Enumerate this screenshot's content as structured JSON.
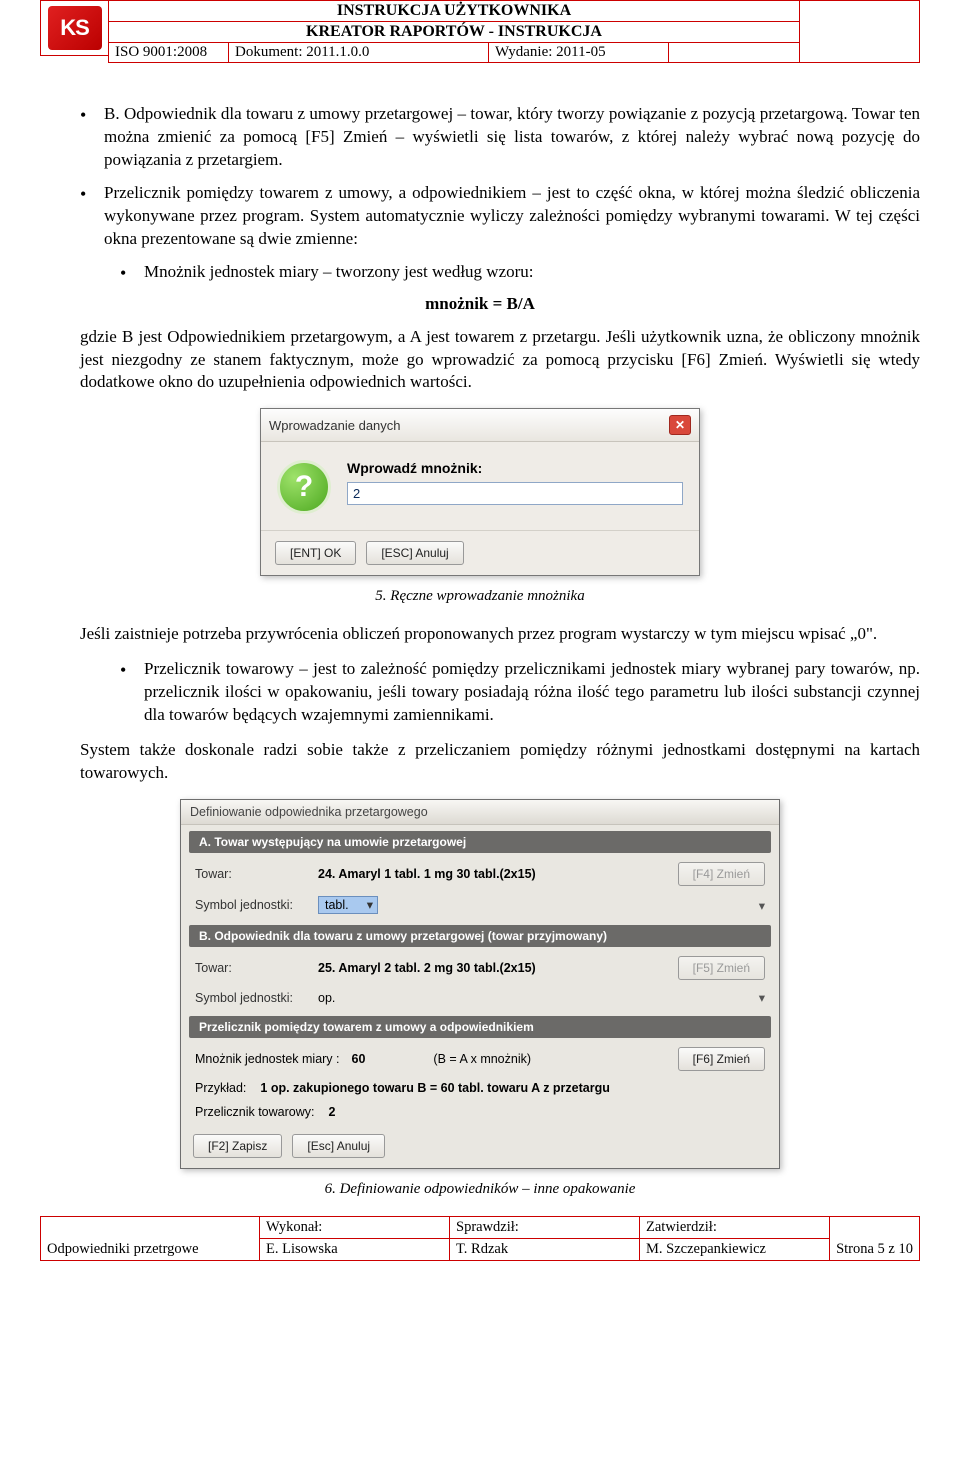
{
  "header": {
    "logo": "KS",
    "title1": "INSTRUKCJA UŻYTKOWNIKA",
    "title2": "KREATOR RAPORTÓW - INSTRUKCJA",
    "iso": "ISO 9001:2008",
    "doc": "Dokument: 2011.1.0.0",
    "wyd": "Wydanie: 2011-05"
  },
  "body": {
    "bullet_b": "B. Odpowiednik dla towaru z umowy przetargowej – towar, który tworzy powiązanie z pozycją przetargową. Towar ten można zmienić za pomocą [F5] Zmień – wyświetli się lista towarów, z której należy wybrać nową pozycję do powiązania z przetargiem.",
    "bullet_prz": "Przelicznik pomiędzy towarem z umowy, a odpowiednikiem – jest to część okna, w której można śledzić obliczenia wykonywane przez program. System automatycznie wyliczy zależności pomiędzy wybranymi towarami. W tej części okna prezentowane są dwie zmienne:",
    "sub_mnoz": "Mnożnik jednostek miary – tworzony jest według wzoru:",
    "formula": "mnożnik = B/A",
    "para_gdzie": "gdzie B jest Odpowiednikiem przetargowym, a A jest towarem z przetargu. Jeśli użytkownik uzna, że obliczony mnożnik jest niezgodny ze stanem faktycznym, może go wprowadzić za pomocą przycisku [F6] Zmień. Wyświetli się wtedy dodatkowe okno do uzupełnienia odpowiednich wartości.",
    "caption5": "5.  Ręczne wprowadzanie mnożnika",
    "para_jesli": "Jeśli zaistnieje potrzeba przywrócenia obliczeń proponowanych przez program wystarczy w tym miejscu wpisać „0\".",
    "bullet_prz_tow": "Przelicznik towarowy – jest to zależność pomiędzy przelicznikami jednostek miary wybranej pary towarów, np. przelicznik ilości w opakowaniu, jeśli towary posiadają różna ilość tego parametru lub ilości substancji czynnej dla towarów będących wzajemnymi zamiennikami.",
    "para_system": "System także doskonale radzi sobie także z przeliczaniem pomiędzy różnymi jednostkami dostępnymi na kartach towarowych.",
    "caption6": "6.  Definiowanie odpowiedników – inne opakowanie"
  },
  "dialog1": {
    "title": "Wprowadzanie danych",
    "label": "Wprowadź mnożnik:",
    "value": "2",
    "ok": "[ENT] OK",
    "cancel": "[ESC] Anuluj"
  },
  "dialog2": {
    "title": "Definiowanie odpowiednika przetargowego",
    "secA": "A. Towar występujący na umowie przetargowej",
    "towarA_lbl": "Towar:",
    "towarA_val": "24. Amaryl 1 tabl. 1 mg 30 tabl.(2x15)",
    "f4": "[F4] Zmień",
    "sym_lbl": "Symbol jednostki:",
    "symA_val": "tabl.",
    "secB": "B. Odpowiednik dla towaru z umowy przetargowej (towar przyjmowany)",
    "towarB_lbl": "Towar:",
    "towarB_val": "25. Amaryl 2 tabl. 2 mg 30 tabl.(2x15)",
    "f5": "[F5] Zmień",
    "symB_val": "op.",
    "secC": "Przelicznik pomiędzy towarem z umowy a odpowiednikiem",
    "mnoz_lbl": "Mnożnik jednostek miary :",
    "mnoz_val": "60",
    "mnoz_formula": "(B = A x mnożnik)",
    "f6": "[F6] Zmień",
    "przyklad_lbl": "Przykład:",
    "przyklad_val": "1 op. zakupionego towaru B  =  60 tabl. towaru A z przetargu",
    "prztow_lbl": "Przelicznik towarowy:",
    "prztow_val": "2",
    "zapisz": "[F2] Zapisz",
    "anuluj": "[Esc] Anuluj"
  },
  "footer": {
    "c1r1": "",
    "c1r2": "Odpowiedniki przetrgowe",
    "wykonal_lbl": "Wykonał:",
    "wykonal_val": "E. Lisowska",
    "sprawdzil_lbl": "Sprawdził:",
    "sprawdzil_val": "T. Rdzak",
    "zatwierdzil_lbl": "Zatwierdził:",
    "zatwierdzil_val": "M. Szczepankiewicz",
    "strona": "Strona 5 z 10"
  }
}
